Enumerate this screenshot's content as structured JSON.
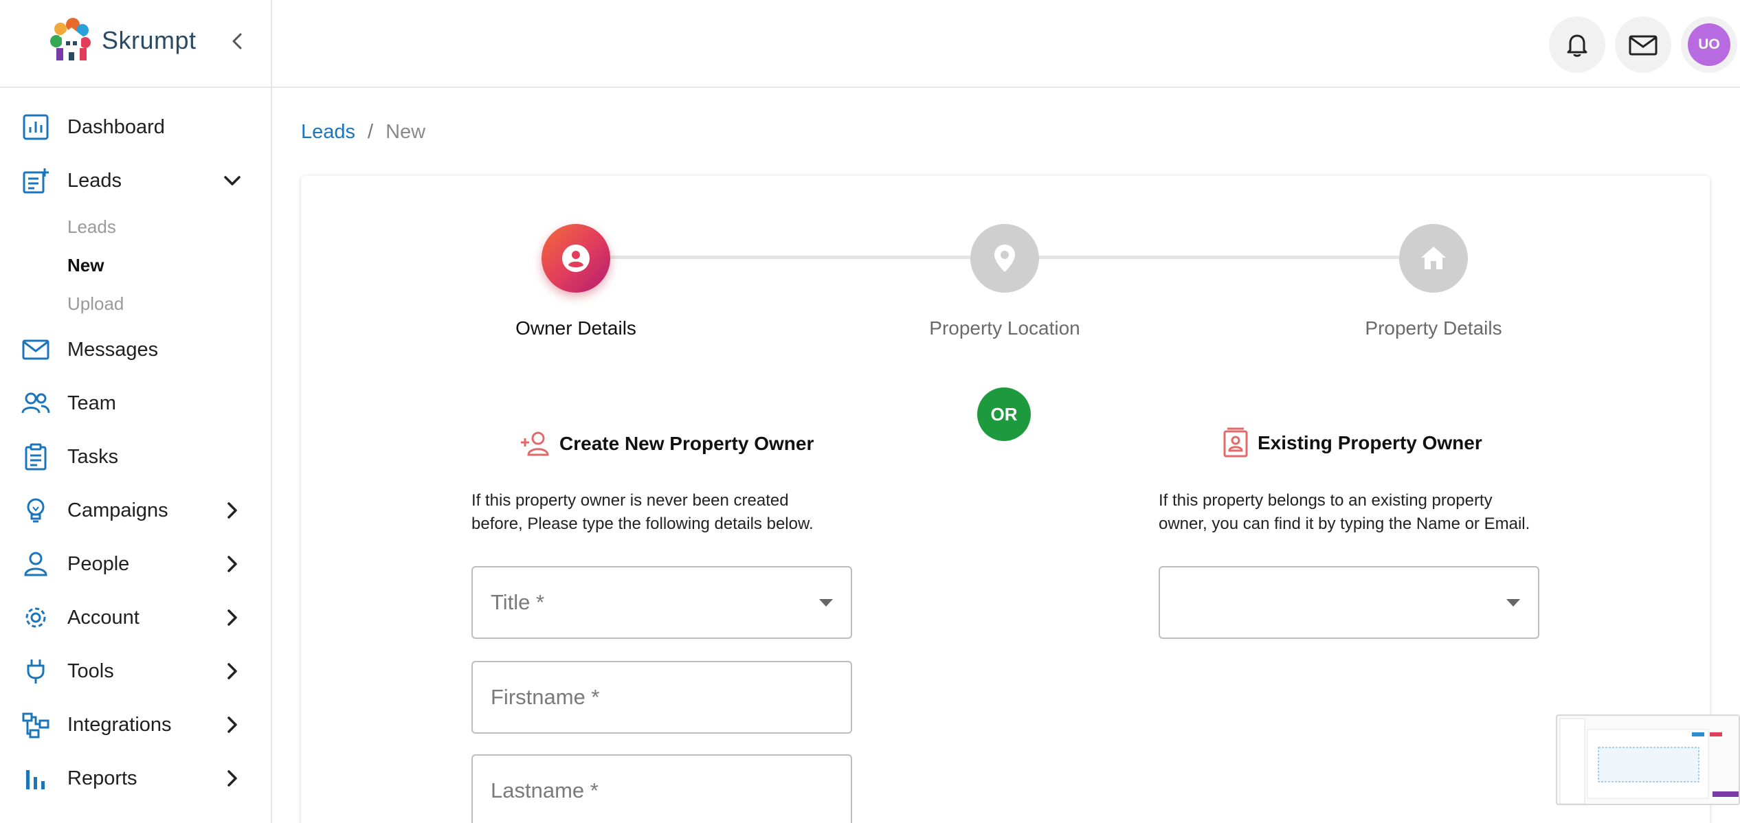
{
  "app": {
    "name": "Skrumpt",
    "avatar_initials": "UO"
  },
  "sidebar": {
    "items": [
      {
        "label": "Dashboard",
        "icon": "dashboard-chart-icon"
      },
      {
        "label": "Leads",
        "icon": "leads-note-icon",
        "expanded": true,
        "children": [
          {
            "label": "Leads"
          },
          {
            "label": "New",
            "active": true
          },
          {
            "label": "Upload"
          }
        ]
      },
      {
        "label": "Messages",
        "icon": "mail-icon"
      },
      {
        "label": "Team",
        "icon": "team-icon"
      },
      {
        "label": "Tasks",
        "icon": "clipboard-icon"
      },
      {
        "label": "Campaigns",
        "icon": "lightbulb-icon"
      },
      {
        "label": "People",
        "icon": "person-icon"
      },
      {
        "label": "Account",
        "icon": "gear-icon"
      },
      {
        "label": "Tools",
        "icon": "plug-icon"
      },
      {
        "label": "Integrations",
        "icon": "integrations-icon"
      },
      {
        "label": "Reports",
        "icon": "bar-chart-icon"
      }
    ]
  },
  "breadcrumb": {
    "link": "Leads",
    "separator": "/",
    "current": "New"
  },
  "stepper": {
    "steps": [
      {
        "label": "Owner Details",
        "icon": "person-circle-icon",
        "active": true
      },
      {
        "label": "Property Location",
        "icon": "map-pin-icon",
        "active": false
      },
      {
        "label": "Property Details",
        "icon": "house-icon",
        "active": false
      }
    ]
  },
  "or_label": "OR",
  "create_section": {
    "title": "Create New Property Owner",
    "desc_line1": "If this property owner is never been created",
    "desc_line2": "before, Please type the following details below.",
    "fields": [
      {
        "placeholder": "Title *",
        "type": "select"
      },
      {
        "placeholder": "Firstname *",
        "type": "text"
      },
      {
        "placeholder": "Lastname *",
        "type": "text"
      }
    ]
  },
  "existing_section": {
    "title": "Existing Property Owner",
    "desc_line1": "If this property belongs to an existing property",
    "desc_line2": "owner, you can find it by typing the Name or Email.",
    "select_value": ""
  },
  "colors": {
    "accent": "#1b75bb",
    "step_active": "#e23e5c",
    "or_badge": "#1e9a3e",
    "avatar": "#b86ae0",
    "section_icon": "#e26a6a"
  }
}
